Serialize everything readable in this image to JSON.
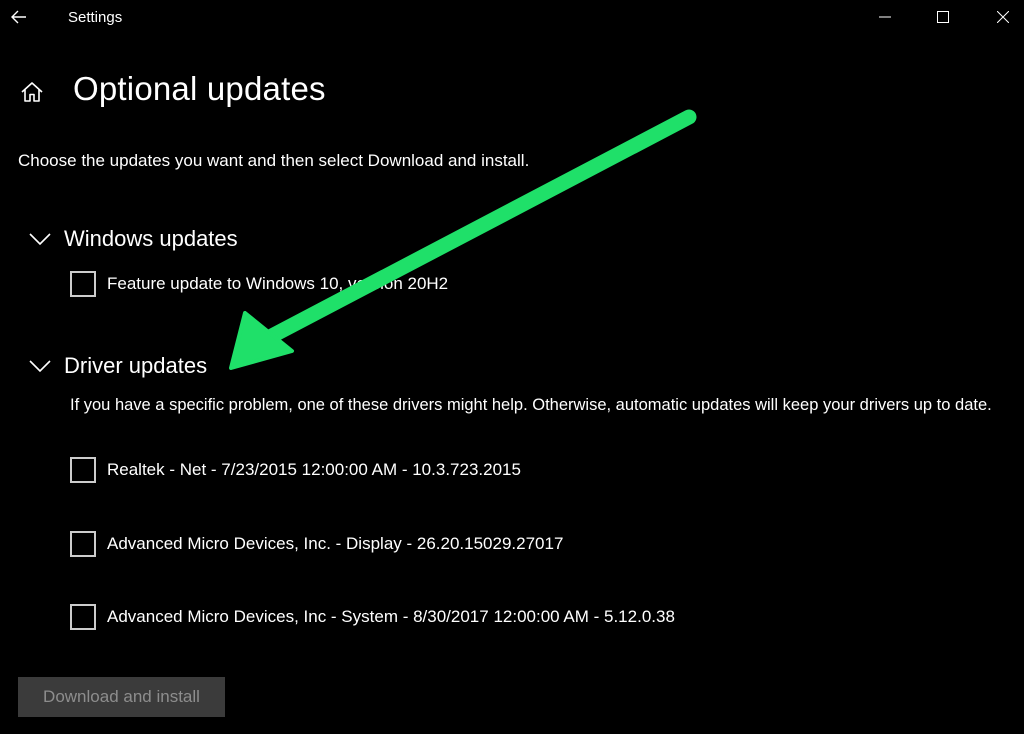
{
  "titlebar": {
    "app_title": "Settings",
    "icons": {
      "back": "back-arrow-icon",
      "minimize": "minimize-icon",
      "maximize": "maximize-icon",
      "close": "close-icon"
    }
  },
  "header": {
    "home_icon": "home-icon",
    "title": "Optional updates"
  },
  "intro": "Choose the updates you want and then select Download and install.",
  "sections": {
    "windows_updates": {
      "title": "Windows updates",
      "items": [
        {
          "label": "Feature update to Windows 10, version 20H2",
          "checked": false
        }
      ]
    },
    "driver_updates": {
      "title": "Driver updates",
      "description": "If you have a specific problem, one of these drivers might help. Otherwise, automatic updates will keep your drivers up to date.",
      "items": [
        {
          "label": "Realtek - Net - 7/23/2015 12:00:00 AM - 10.3.723.2015",
          "checked": false
        },
        {
          "label": "Advanced Micro Devices, Inc. - Display - 26.20.15029.27017",
          "checked": false
        },
        {
          "label": "Advanced Micro Devices, Inc - System - 8/30/2017 12:00:00 AM - 5.12.0.38",
          "checked": false
        }
      ]
    }
  },
  "actions": {
    "download_install_label": "Download and install",
    "download_install_enabled": false
  },
  "colors": {
    "background": "#000000",
    "text": "#ffffff",
    "checkbox_border": "#cccccc",
    "button_disabled_bg": "#3b3b3b",
    "button_disabled_text": "#8d8d8d",
    "annotation_arrow": "#1fe069"
  }
}
